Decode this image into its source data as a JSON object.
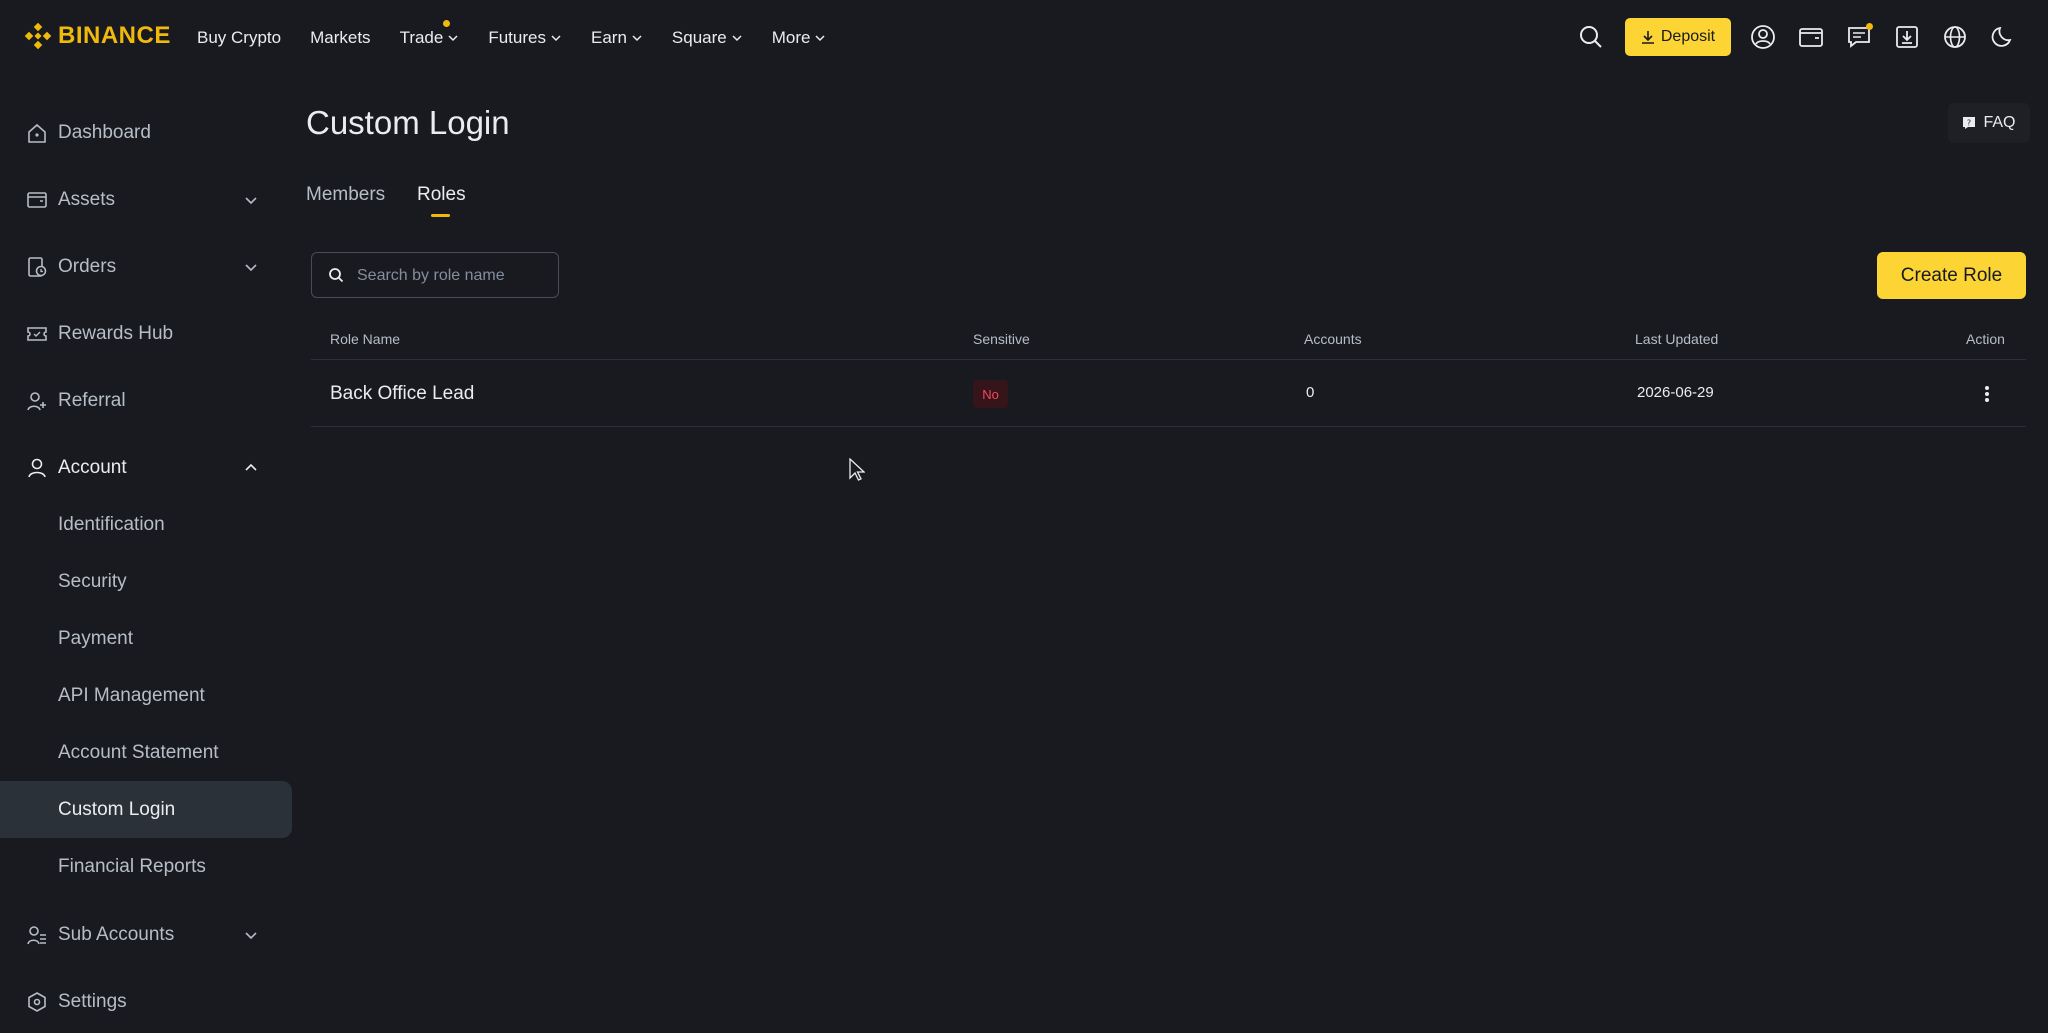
{
  "brand": {
    "name": "BINANCE",
    "accent": "#f0b90b"
  },
  "topnav": {
    "items": [
      {
        "label": "Buy Crypto",
        "dropdown": false
      },
      {
        "label": "Markets",
        "dropdown": false
      },
      {
        "label": "Trade",
        "dropdown": true,
        "dot": true
      },
      {
        "label": "Futures",
        "dropdown": true
      },
      {
        "label": "Earn",
        "dropdown": true
      },
      {
        "label": "Square",
        "dropdown": true
      },
      {
        "label": "More",
        "dropdown": true
      }
    ],
    "deposit_label": "Deposit",
    "icons": [
      "search-icon",
      "user-icon",
      "wallet-icon",
      "message-icon",
      "download-icon",
      "globe-icon",
      "moon-icon"
    ]
  },
  "sidebar": {
    "items": [
      {
        "label": "Dashboard",
        "icon": "home-icon"
      },
      {
        "label": "Assets",
        "icon": "wallet-icon",
        "expandable": true
      },
      {
        "label": "Orders",
        "icon": "orders-icon",
        "expandable": true
      },
      {
        "label": "Rewards Hub",
        "icon": "ticket-icon"
      },
      {
        "label": "Referral",
        "icon": "user-plus-icon"
      },
      {
        "label": "Account",
        "icon": "person-icon",
        "expanded": true
      }
    ],
    "account_sub": [
      "Identification",
      "Security",
      "Payment",
      "API Management",
      "Account Statement",
      "Custom Login",
      "Financial Reports"
    ],
    "selected_sub": "Custom Login",
    "bottom_items": [
      {
        "label": "Sub Accounts",
        "icon": "sub-accounts-icon",
        "expandable": true
      },
      {
        "label": "Settings",
        "icon": "settings-icon"
      }
    ]
  },
  "main": {
    "title": "Custom Login",
    "faq_label": "FAQ",
    "tabs": [
      {
        "label": "Members",
        "active": false
      },
      {
        "label": "Roles",
        "active": true
      }
    ],
    "search": {
      "placeholder": "Search by role name",
      "value": ""
    },
    "create_label": "Create Role",
    "table": {
      "columns": [
        "Role Name",
        "Sensitive",
        "Accounts",
        "Last Updated",
        "Action"
      ],
      "rows": [
        {
          "role_name": "Back Office Lead",
          "sensitive": "No",
          "accounts": "0",
          "last_updated": "2026-06-29"
        }
      ]
    }
  },
  "colors": {
    "background": "#181a20",
    "button_yellow": "#fcd535",
    "danger": "#f6465d",
    "selected_bg": "#2b3139"
  }
}
